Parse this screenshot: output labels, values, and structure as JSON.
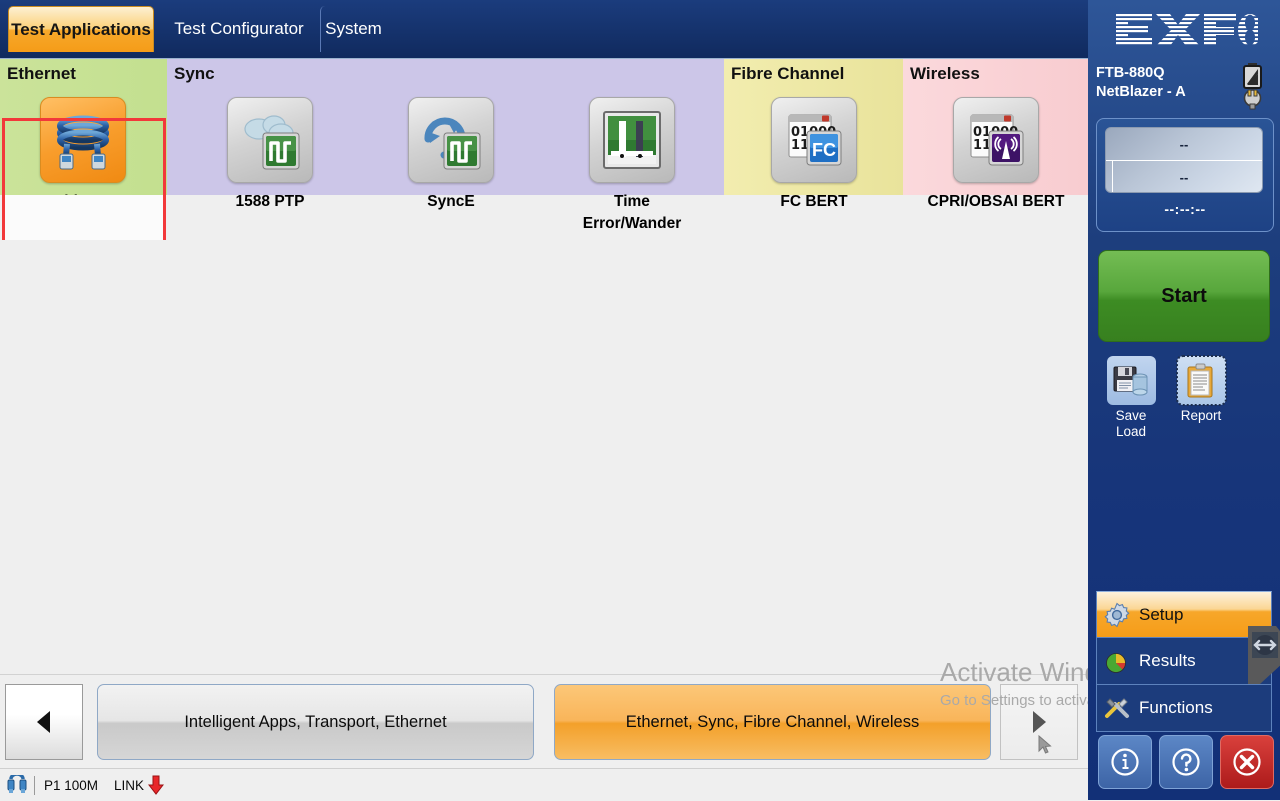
{
  "tabs": [
    {
      "id": "test-applications",
      "label": "Test Applications",
      "active": true
    },
    {
      "id": "test-configurator",
      "label": "Test Configurator",
      "active": false
    },
    {
      "id": "system",
      "label": "System",
      "active": false
    }
  ],
  "categories": [
    {
      "id": "ethernet",
      "title": "Ethernet",
      "color": "#c3e08f",
      "apps": [
        {
          "id": "cable-test",
          "label": "Cable Test",
          "icon": "network-cable-icon",
          "selected": true
        }
      ]
    },
    {
      "id": "sync",
      "title": "Sync",
      "color": "#ccc6e8",
      "apps": [
        {
          "id": "1588-ptp",
          "label": "1588 PTP",
          "icon": "cloud-waveform-icon",
          "selected": false
        },
        {
          "id": "synce",
          "label": "SyncE",
          "icon": "sync-waveform-icon",
          "selected": false
        },
        {
          "id": "time-error-wander",
          "label": "Time\nError/Wander",
          "icon": "wander-chart-icon",
          "selected": false
        }
      ]
    },
    {
      "id": "fibre-channel",
      "title": "Fibre Channel",
      "color": "#e9e39b",
      "apps": [
        {
          "id": "fc-bert",
          "label": "FC BERT",
          "icon": "fc-bert-icon",
          "selected": false
        }
      ]
    },
    {
      "id": "wireless",
      "title": "Wireless",
      "color": "#f8ccd0",
      "apps": [
        {
          "id": "cpri-obsai-bert",
          "label": "CPRI/OBSAI BERT",
          "icon": "antenna-bert-icon",
          "selected": false
        }
      ]
    }
  ],
  "bottom_nav": {
    "prev_icon": "left-triangle-icon",
    "next_icon": "right-triangle-icon",
    "left_button": "Intelligent Apps, Transport, Ethernet",
    "right_button": "Ethernet, Sync, Fibre Channel, Wireless"
  },
  "status_bar": {
    "port_icon": "cable-connector-icon",
    "port": "P1 100M",
    "link_label": "LINK",
    "link_state_icon": "red-down-arrow-icon"
  },
  "sidebar": {
    "brand": "EXFO",
    "device_line1": "FTB-880Q",
    "device_line2": "NetBlazer  - A",
    "battery_icon": "battery-charging-icon",
    "timer": {
      "row1": "--",
      "row2": "--",
      "clock": "--:--:--"
    },
    "start_button": "Start",
    "tools": [
      {
        "id": "save-load",
        "label_line1": "Save",
        "label_line2": "Load",
        "icon": "floppy-disk-icon"
      },
      {
        "id": "report",
        "label_line1": "Report",
        "label_line2": "",
        "icon": "clipboard-icon"
      }
    ],
    "menu": [
      {
        "id": "setup",
        "label": "Setup",
        "icon": "gear-icon",
        "selected": true
      },
      {
        "id": "results",
        "label": "Results",
        "icon": "pie-chart-icon",
        "selected": false
      },
      {
        "id": "functions",
        "label": "Functions",
        "icon": "tools-icon",
        "selected": false
      }
    ],
    "action_buttons": [
      {
        "id": "info",
        "icon": "info-icon",
        "color": "#3d64a6"
      },
      {
        "id": "help",
        "icon": "question-icon",
        "color": "#3d64a6"
      },
      {
        "id": "close",
        "icon": "close-x-icon",
        "color": "#ad1b1b"
      }
    ],
    "drag_handle_icon": "horizontal-resize-icon"
  },
  "watermark": {
    "line1": "Activate Windows",
    "line2": "Go to Settings to activate Windows."
  },
  "colors": {
    "accent_orange": "#f7a82a",
    "selection_red": "#f2383a",
    "brand_blue": "#1d3e7d",
    "start_green": "#3d8c23"
  }
}
